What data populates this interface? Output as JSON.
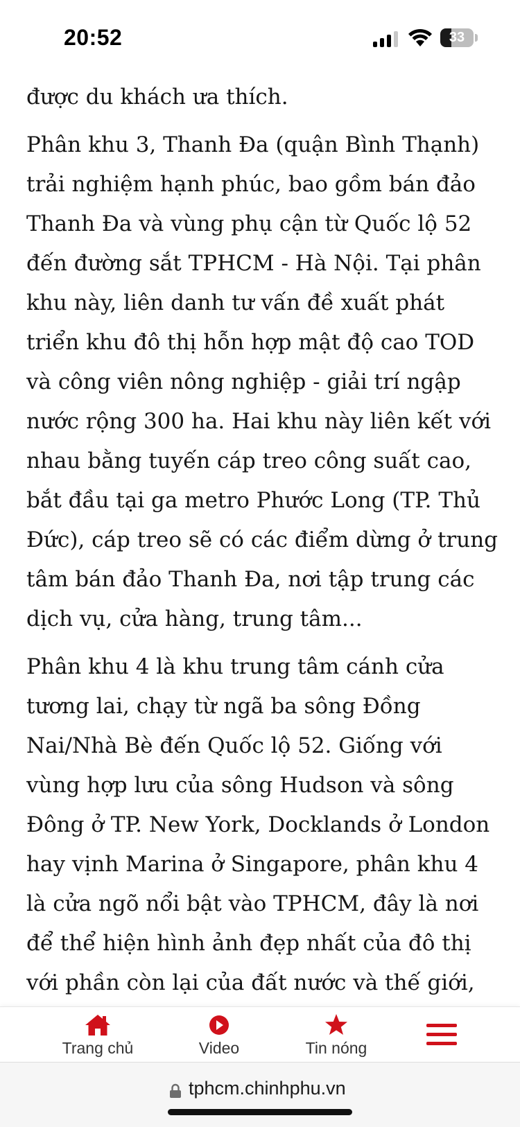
{
  "status_bar": {
    "time": "20:52",
    "battery_level": "33",
    "battery_fraction": 0.33
  },
  "article": {
    "paragraphs": [
      "được du khách ưa thích.",
      "Phân khu 3, Thanh Đa (quận Bình Thạnh) trải nghiệm hạnh phúc, bao gồm bán đảo Thanh Đa và vùng phụ cận từ Quốc lộ 52 đến đường sắt TPHCM - Hà Nội. Tại phân khu này, liên danh tư vấn đề xuất phát triển khu đô thị hỗn hợp mật độ cao TOD và công viên nông nghiệp - giải trí ngập nước rộng 300 ha. Hai khu này liên kết với nhau bằng tuyến cáp treo công suất cao, bắt đầu tại ga metro Phước Long (TP. Thủ Đức), cáp treo sẽ có các điểm dừng ở trung tâm bán đảo Thanh Đa, nơi tập trung các dịch vụ, cửa hàng, trung tâm...",
      "Phân khu 4 là khu trung tâm cánh cửa tương lai, chạy từ ngã ba sông Đồng Nai/Nhà Bè đến Quốc lộ 52. Giống với vùng hợp lưu của sông Hudson và sông Đông ở TP. New York, Docklands ở London hay vịnh Marina ở Singapore, phân khu 4 là cửa ngõ nổi bật vào TPHCM, đây là nơi để thể hiện hình ảnh đẹp nhất của đô thị với phần còn lại của đất nước và thế giới, đồng"
    ]
  },
  "bottom_nav": {
    "items": [
      {
        "label": "Trang chủ",
        "icon": "home-icon"
      },
      {
        "label": "Video",
        "icon": "play-icon"
      },
      {
        "label": "Tin nóng",
        "icon": "star-icon"
      }
    ],
    "menu_icon": "hamburger-menu-icon",
    "accent_color": "#d0111b"
  },
  "browser": {
    "url": "tphcm.chinhphu.vn"
  }
}
